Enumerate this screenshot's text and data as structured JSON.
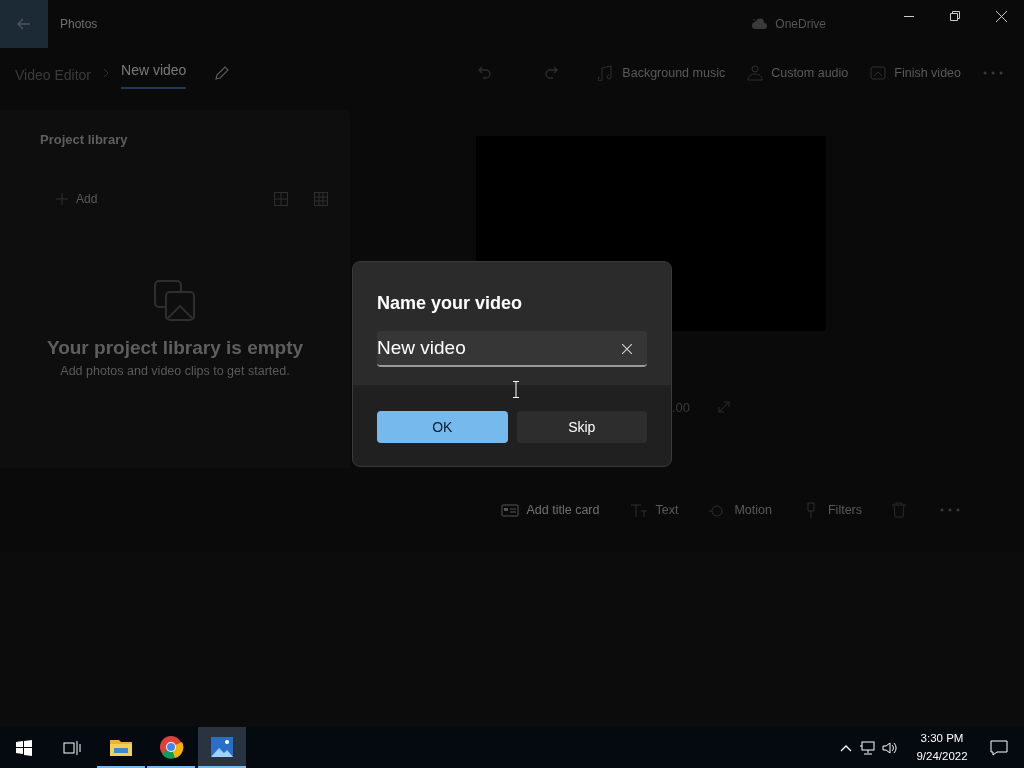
{
  "window": {
    "title": "Photos",
    "cloud": "OneDrive"
  },
  "breadcrumb": [
    {
      "label": "Video Editor",
      "selected": false
    },
    {
      "label": "New video",
      "selected": true
    }
  ],
  "toolbar": [
    "Background music",
    "Custom audio",
    "Finish video"
  ],
  "project_library": {
    "title": "Project library",
    "add": "Add",
    "empty_title": "Your project library is empty",
    "empty_hint": "Add photos and video clips to get started."
  },
  "preview": {
    "time": ".00"
  },
  "storyboard_toolbar": [
    "Add title card",
    "Text",
    "Motion",
    "Filters"
  ],
  "dialog": {
    "title": "Name your video",
    "value": "New video",
    "buttons": [
      {
        "label": "OK",
        "kind": "primary"
      },
      {
        "label": "Skip",
        "kind": "secondary"
      }
    ]
  },
  "taskbar": {
    "apps": [
      {
        "kind": "folder",
        "selected": false
      },
      {
        "kind": "browser",
        "selected": false
      },
      {
        "kind": "photos",
        "selected": true
      }
    ],
    "time": "3:30 PM",
    "date": "9/24/2022"
  }
}
